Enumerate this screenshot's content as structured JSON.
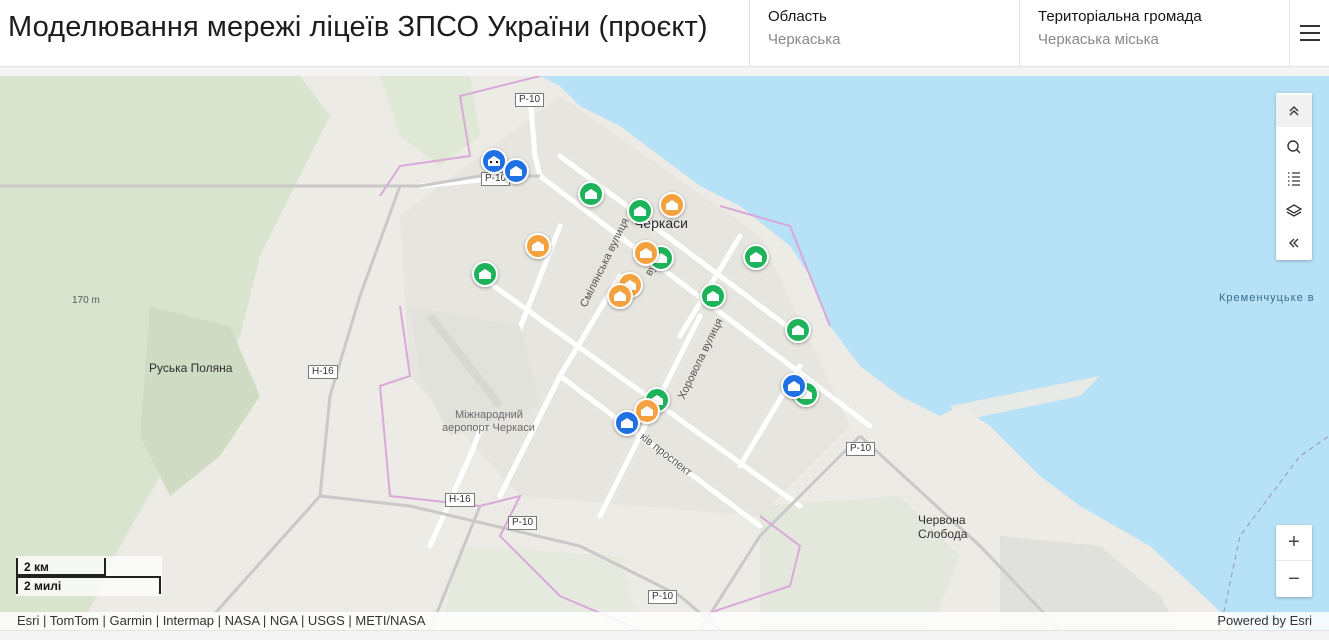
{
  "header": {
    "title": "Моделювання мережі ліцеїв ЗПСО України (проєкт)",
    "filters": [
      {
        "label": "Область",
        "value": "Черкаська"
      },
      {
        "label": "Територіальна громада",
        "value": "Черкаська міська"
      }
    ],
    "menu_icon": "hamburger-menu-icon"
  },
  "map": {
    "labels": {
      "city": "Черкаси",
      "ruska_poliana": "Руська Поляна",
      "chervona_sloboda_1": "Червона",
      "chervona_sloboda_2": "Слобода",
      "reservoir": "Кременчуцьке в",
      "airport_1": "Міжнародний",
      "airport_2": "аеропорт Черкаси",
      "elevation": "170 m",
      "street_smilianska": "Смілянська вулиця",
      "street_khorovola": "Хоровола вулиця",
      "street_prospect": "ків проспект",
      "street_partial": "вуллі"
    },
    "road_shields": {
      "r10_top": "P-10",
      "r10_left": "P-10",
      "r10_right": "P-10",
      "r10_bottom": "P-10",
      "r10_bottom2": "P-10",
      "h16_left": "H-16",
      "h16_bottom": "H-16"
    },
    "colors": {
      "water": "#b6e1f6",
      "land": "#ecebe5",
      "forest": "#d6e2cb",
      "green_marker": "#1eb35a",
      "orange_marker": "#f4a23f",
      "blue_marker": "#1f6fe5",
      "boundary": "#d9a9d9"
    },
    "marker_icon": "school-building-icon",
    "tools": [
      "collapse-up-icon",
      "search-icon",
      "legend-list-icon",
      "layers-icon",
      "collapse-left-icon"
    ],
    "zoom": {
      "in": "+",
      "out": "−"
    },
    "scale": {
      "km": "2 км",
      "mi": "2 милі"
    },
    "attribution": {
      "left": "Esri | TomTom | Garmin | Intermap | NASA | NGA | USGS | METI/NASA",
      "right": "Powered by Esri"
    }
  }
}
